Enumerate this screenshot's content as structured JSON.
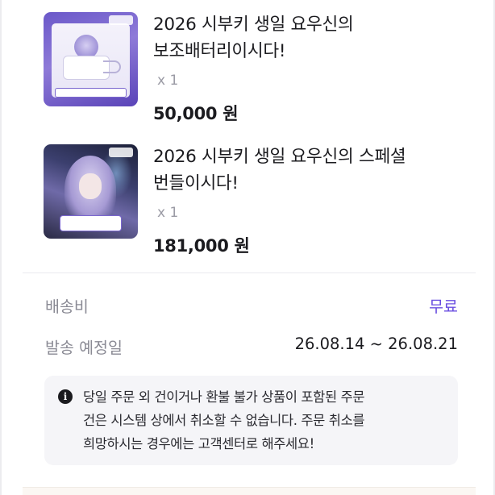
{
  "order_items": [
    {
      "title": "2026 시부키 생일 요우신의\n보조배터리이시다!",
      "quantity": "x 1",
      "price": "50,000 원",
      "thumbnail_icon": "power-bank-merch-image"
    },
    {
      "title": "2026 시부키 생일 요우신의 스페셜\n번들이시다!",
      "quantity": "x 1",
      "price": "181,000 원",
      "thumbnail_icon": "special-bundle-artwork-image"
    }
  ],
  "shipping": {
    "fee_label": "배송비",
    "fee_value": "무료",
    "date_label": "발송 예정일",
    "date_value": "26.08.14 ~ 26.08.21"
  },
  "notice": {
    "icon": "info-icon",
    "icon_glyph": "i",
    "text": "당일 주문 외 건이거나 환불 불가 상품이 포함된 주문\n건은 시스템 상에서 취소할 수 없습니다. 주문 취소를\n희망하시는 경우에는 고객센터로 해주세요!"
  },
  "colors": {
    "accent": "#6a4ee0",
    "label_gray": "#8a8a94",
    "notice_bg": "#f5f5f8"
  }
}
